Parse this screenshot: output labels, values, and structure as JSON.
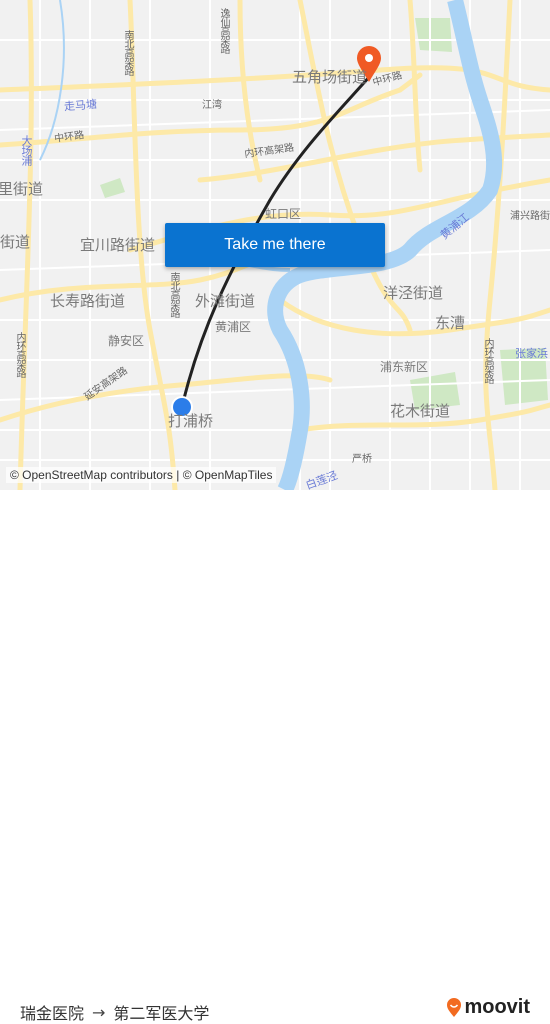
{
  "map": {
    "labels": {
      "wujiaochang": "五角场街道",
      "zhonghuan_ne": "中环路",
      "zhonghuan_w": "中环路",
      "neihuan": "内环高架路",
      "hongkou": "虹口区",
      "nanbei_n": "南北高架路",
      "yixian": "逸仙高架路",
      "zoumatang": "走马塘",
      "dachangpu": "大场浦",
      "jiangwan": "江湾",
      "jiedao_w": "里街道",
      "jiedao_w2": "街道",
      "yichuan": "宜川路街道",
      "changshou": "长寿路街道",
      "waitan": "外滩街道",
      "huangpu": "黄浦区",
      "jingan": "静安区",
      "yanan": "延安高架路",
      "nanbei_s": "南北高架路",
      "neihuan_w": "内环高架路",
      "neihuan_e": "内环高架路",
      "yangjing": "洋泾街道",
      "dongcao": "东漕",
      "pudong": "浦东新区",
      "huamu": "花木街道",
      "dapuqiao": "打浦桥",
      "huangpujiang": "黄浦江",
      "zhangjiabang": "张家浜",
      "puxinglu": "浦兴路街",
      "bailianjing": "白莲泾",
      "yanqiao": "严桥"
    },
    "origin_color": "#2b7de9",
    "destination_color": "#f05a24",
    "route_color": "#222222"
  },
  "take_me_there": "Take me there",
  "attribution": "© OpenStreetMap contributors | © OpenMapTiles",
  "footer": {
    "origin": "瑞金医院",
    "arrow": "→",
    "destination": "第二军医大学",
    "brand": "moovit",
    "brand_color": "#f26b21"
  }
}
